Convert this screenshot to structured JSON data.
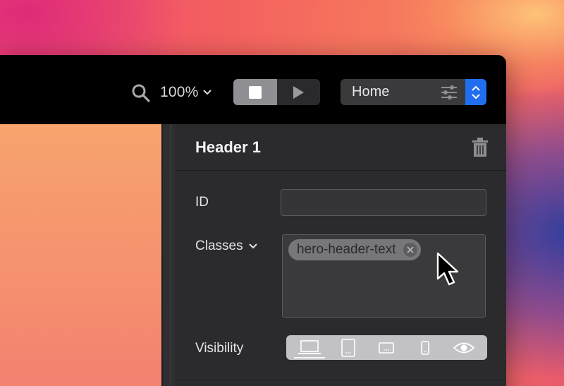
{
  "toolbar": {
    "zoom_label": "100%",
    "page_select": {
      "value": "Home"
    },
    "mode_toggle": {
      "active": "stop"
    }
  },
  "panel": {
    "title": "Header 1",
    "id_field": {
      "label": "ID",
      "value": ""
    },
    "classes": {
      "label": "Classes",
      "chips": [
        "hero-header-text"
      ]
    },
    "visibility": {
      "label": "Visibility",
      "options": [
        "desktop",
        "tablet-portrait",
        "tablet-landscape",
        "phone",
        "preview"
      ],
      "selected": "desktop"
    }
  },
  "colors": {
    "accent": "#1f6ff0",
    "toolbar_bg": "#000000",
    "panel_bg": "#2b2b2d"
  },
  "icons": [
    "search-icon",
    "chevron-down-icon",
    "stop-icon",
    "play-icon",
    "sliders-icon",
    "stepper-icon",
    "trash-icon",
    "close-icon",
    "desktop-icon",
    "tablet-icon",
    "tablet-landscape-icon",
    "phone-icon",
    "eye-icon",
    "cursor-icon"
  ]
}
